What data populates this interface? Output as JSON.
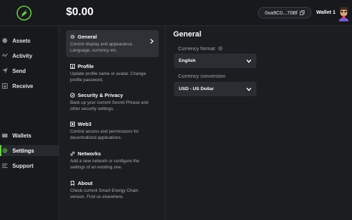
{
  "header": {
    "balance": "$0.00",
    "address": "0xa9C0...70Bf",
    "wallet_name": "Wallet 1"
  },
  "colors": {
    "accent": "#6bd13f",
    "background": "#1b1d21",
    "sidebar": "#17191c",
    "active_item": "#2e3135"
  },
  "sidebar": {
    "items": [
      {
        "label": "Assets",
        "icon": "coin-icon"
      },
      {
        "label": "Activity",
        "icon": "activity-icon"
      },
      {
        "label": "Send",
        "icon": "send-icon"
      },
      {
        "label": "Receive",
        "icon": "receive-icon"
      },
      {
        "label": "Wallets",
        "icon": "wallet-icon"
      },
      {
        "label": "Settings",
        "icon": "gear-icon",
        "active": true
      },
      {
        "label": "Support",
        "icon": "support-icon"
      }
    ]
  },
  "settings": {
    "items": [
      {
        "title": "General",
        "desc": "Control display and appearance. Language, currency etc.",
        "icon": "gear-icon",
        "active": true
      },
      {
        "title": "Profile",
        "desc": "Update profile name or avatar. Change profile password.",
        "icon": "profile-icon"
      },
      {
        "title": "Security & Privacy",
        "desc": "Back up your current Secret Phrase and other security settings.",
        "icon": "shield-icon"
      },
      {
        "title": "Web3",
        "desc": "Control access and permissions for decentralized applications.",
        "icon": "web3-icon"
      },
      {
        "title": "Networks",
        "desc": "Add a new network or configure the settings of an existing one.",
        "icon": "network-icon"
      },
      {
        "title": "About",
        "desc": "Check current Smart Energy Chain version. Find us elsewhere.",
        "icon": "info-icon"
      }
    ]
  },
  "general": {
    "title": "General",
    "currency_format_label": "Currency format",
    "currency_format_value": "English",
    "currency_conversion_label": "Currency conversion",
    "currency_conversion_value": "USD - US Dollar"
  }
}
